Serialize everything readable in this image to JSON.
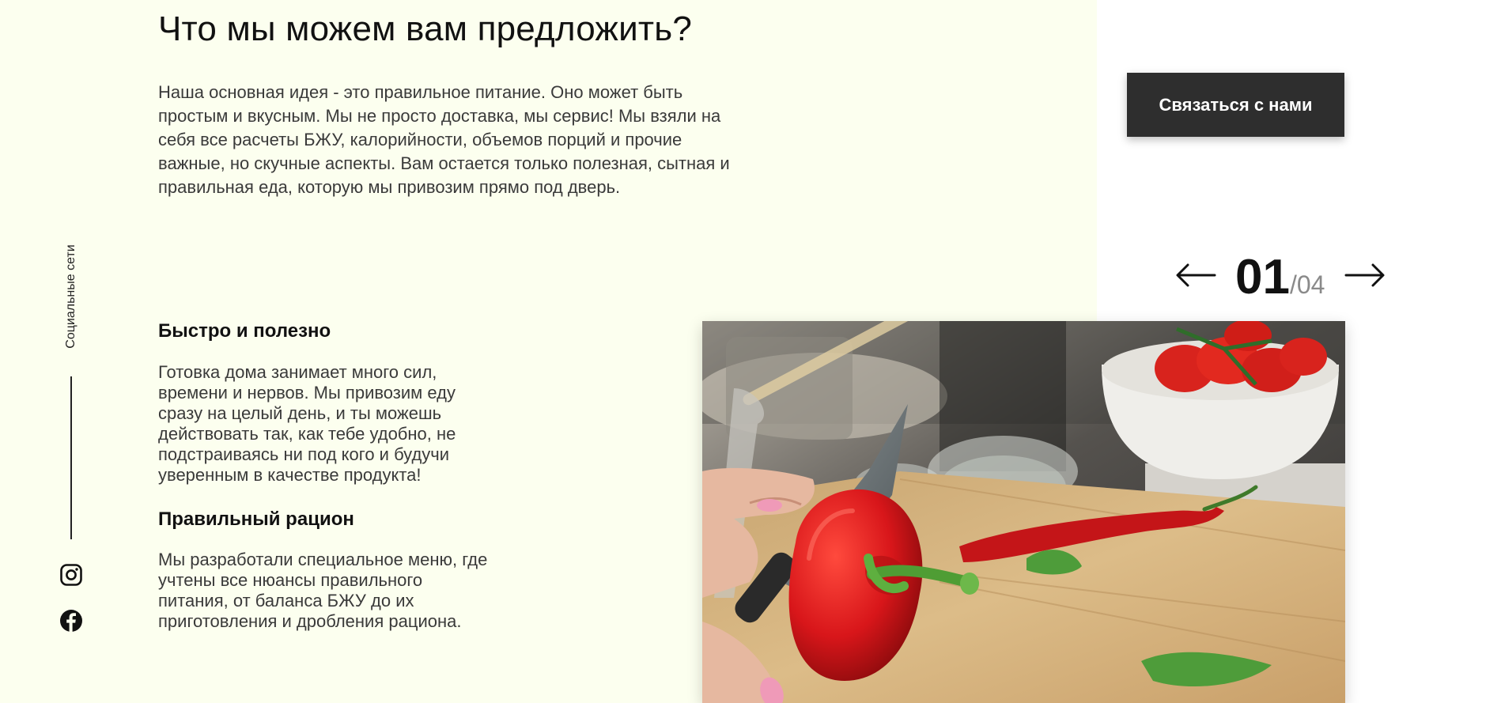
{
  "section": {
    "title": "Что мы можем вам предложить?",
    "intro": "Наша основная идея - это правильное питание. Оно может быть простым и вкусным. Мы не просто доставка, мы сервис! Мы взяли на себя все расчеты БЖУ, калорийности, объемов порций и прочие важные, но скучные аспекты. Вам остается только полезная, сытная и правильная еда, которую мы привозим прямо под дверь."
  },
  "social": {
    "label": "Социальные сети",
    "icons": [
      "instagram-icon",
      "facebook-icon"
    ]
  },
  "features": [
    {
      "title": "Быстро и полезно",
      "text": "Готовка дома занимает много сил, времени и нервов. Мы привозим еду сразу на целый день, и ты можешь действовать так, как тебе удобно, не подстраиваясь ни под кого и будучи уверенным в качестве продукта!"
    },
    {
      "title": "Правильный рацион",
      "text": "Мы разработали специальное меню, где учтены все нюансы правильного питания, от баланса БЖУ до их приготовления и дробления рациона."
    }
  ],
  "cta": {
    "label": "Связаться с нами"
  },
  "slider": {
    "current": "01",
    "total": "/04",
    "icons": [
      "arrow-left-icon",
      "arrow-right-icon"
    ]
  },
  "colors": {
    "panel_bg": "#fcffef",
    "button_bg": "#2e2e2e",
    "pepper_red": "#d8161a",
    "board_wood": "#d8b47c"
  }
}
